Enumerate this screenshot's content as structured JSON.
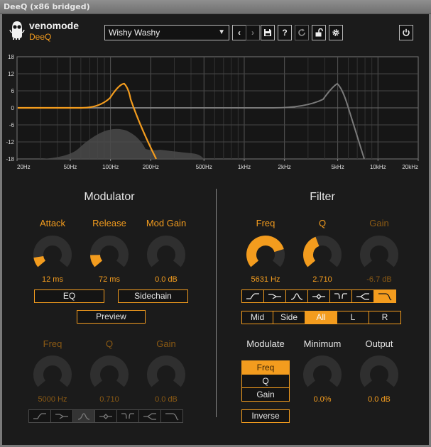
{
  "window": {
    "title": "DeeQ (x86 bridged)"
  },
  "header": {
    "brand": "venomode",
    "product": "DeeQ",
    "preset": "Wishy Washy",
    "buttons": {
      "prev": "‹",
      "next": "›",
      "save": "💾",
      "help": "?",
      "compare": "↻",
      "lock": "🔓",
      "settings": "⚙",
      "power": "⏻"
    }
  },
  "graph": {
    "y_ticks": [
      "18",
      "12",
      "6",
      "0",
      "-6",
      "-12",
      "-18"
    ],
    "x_ticks": [
      "20Hz",
      "50Hz",
      "100Hz",
      "200Hz",
      "500Hz",
      "1kHz",
      "2kHz",
      "5kHz",
      "10kHz",
      "20kHz"
    ],
    "colors": {
      "active_curve": "#f39c1e",
      "inactive_curve": "#7a7a7a",
      "grid": "#555555"
    }
  },
  "modulator": {
    "title": "Modulator",
    "attack": {
      "label": "Attack",
      "value": "12 ms",
      "level": 0.12
    },
    "release": {
      "label": "Release",
      "value": "72 ms",
      "level": 0.15
    },
    "mod_gain": {
      "label": "Mod Gain",
      "value": "0.0 dB",
      "level": 0.0
    },
    "eq_button": "EQ",
    "sidechain_button": "Sidechain",
    "preview_button": "Preview",
    "freq": {
      "label": "Freq",
      "value": "5000 Hz"
    },
    "q": {
      "label": "Q",
      "value": "0.710"
    },
    "gain": {
      "label": "Gain",
      "value": "0.0 dB"
    },
    "selected_shape": 2
  },
  "filter": {
    "title": "Filter",
    "freq": {
      "label": "Freq",
      "value": "5631 Hz",
      "level": 0.78
    },
    "q": {
      "label": "Q",
      "value": "2.710",
      "level": 0.42
    },
    "gain": {
      "label": "Gain",
      "value": "-6.7 dB",
      "level": 0.0
    },
    "selected_shape": 6,
    "channels": [
      "Mid",
      "Side",
      "All",
      "L",
      "R"
    ],
    "selected_channel": "All",
    "modulate_label": "Modulate",
    "modulate_options": [
      "Freq",
      "Q",
      "Gain"
    ],
    "selected_modulate": "Freq",
    "inverse_button": "Inverse",
    "minimum": {
      "label": "Minimum",
      "value": "0.0%"
    },
    "output": {
      "label": "Output",
      "value": "0.0 dB"
    }
  }
}
